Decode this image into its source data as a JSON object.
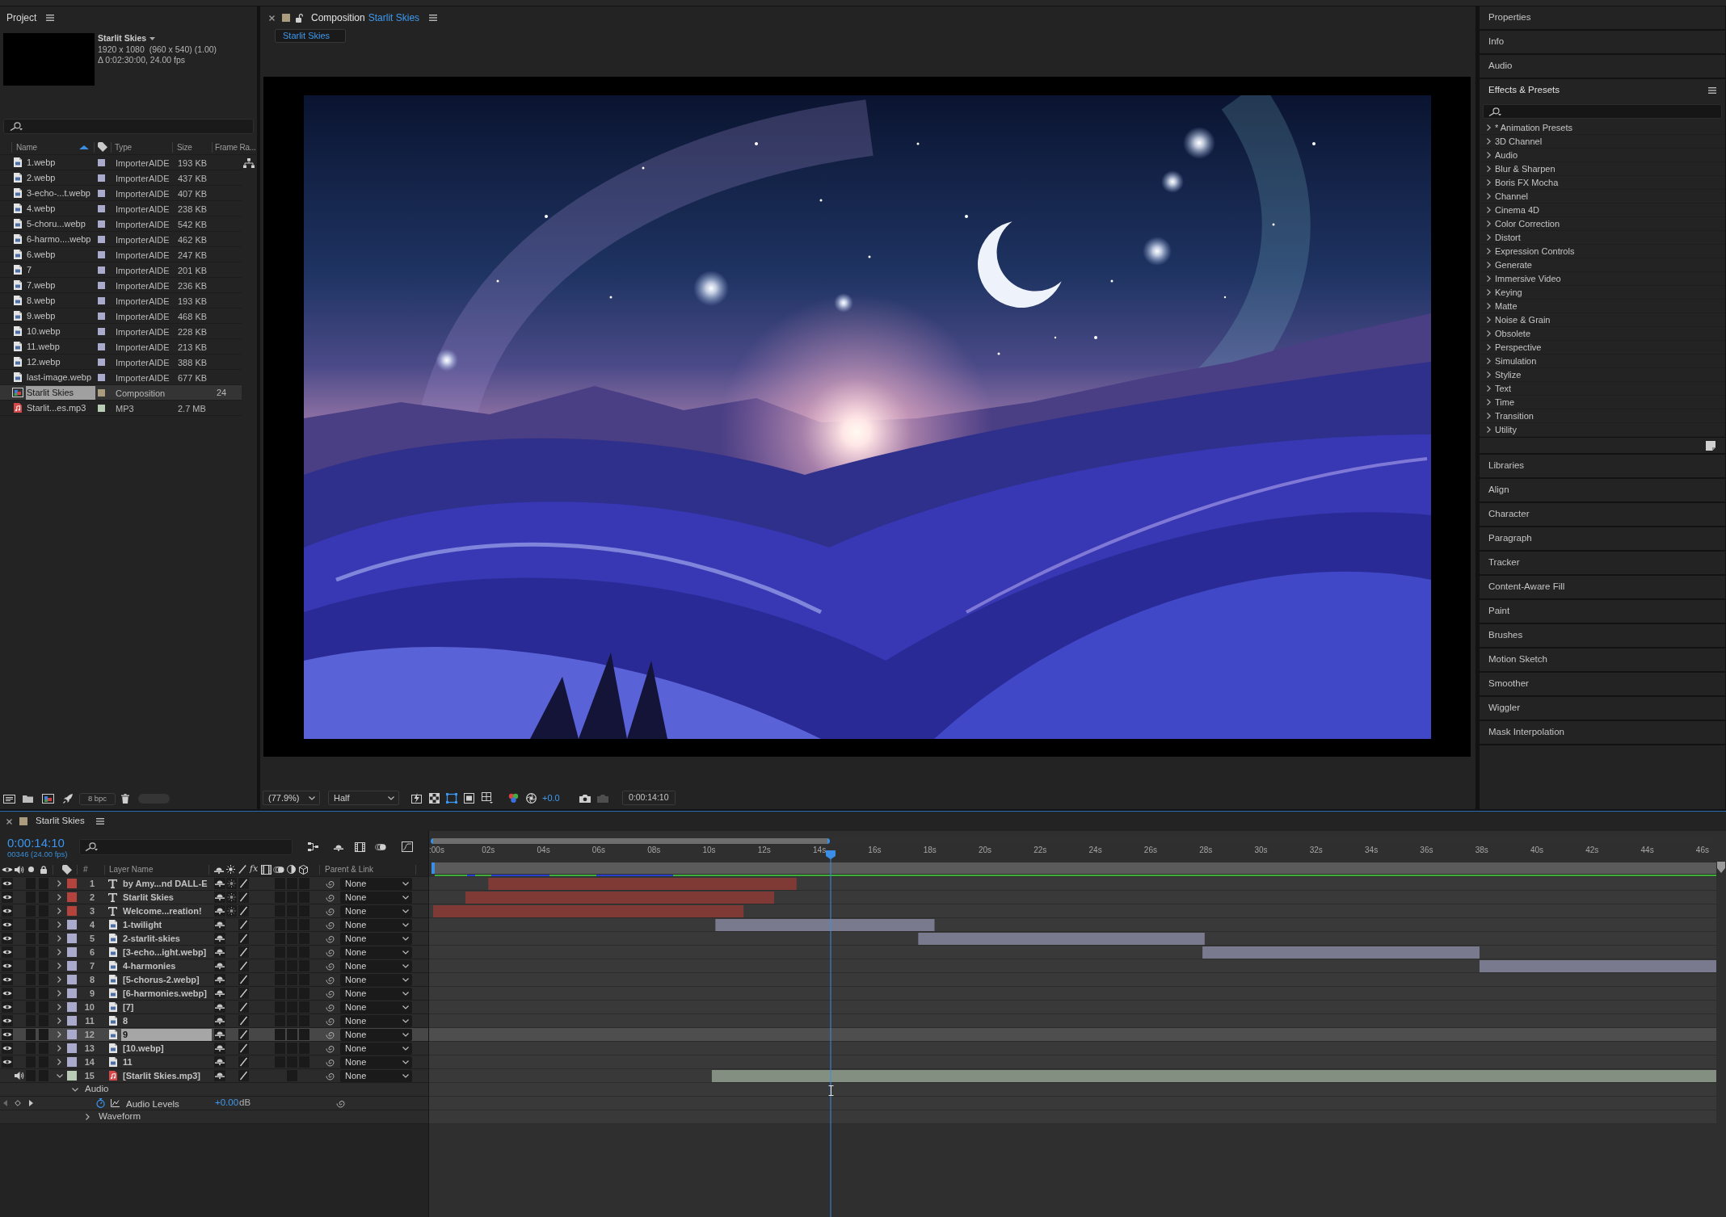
{
  "project": {
    "title": "Project",
    "preview": {
      "name": "Starlit Skies",
      "dimensions": "1920 x 1080  (960 x 540) (1.00)",
      "duration": "Δ 0:02:30:00, 24.00 fps"
    },
    "columns": [
      {
        "label": "Name",
        "sorted": true
      },
      {
        "label": "Type",
        "sorted": false
      },
      {
        "label": "Size",
        "sorted": false
      },
      {
        "label": "Frame Ra...",
        "sorted": false
      }
    ],
    "items": [
      {
        "kind": "image",
        "name": "1.webp",
        "color": "#aaaacc",
        "type": "ImporterAIDE",
        "size": "193 KB",
        "selected": false
      },
      {
        "kind": "image",
        "name": "2.webp",
        "color": "#aaaacc",
        "type": "ImporterAIDE",
        "size": "437 KB",
        "selected": false
      },
      {
        "kind": "image",
        "name": "3-echo-...t.webp",
        "color": "#aaaacc",
        "type": "ImporterAIDE",
        "size": "407 KB",
        "selected": false
      },
      {
        "kind": "image",
        "name": "4.webp",
        "color": "#aaaacc",
        "type": "ImporterAIDE",
        "size": "238 KB",
        "selected": false
      },
      {
        "kind": "image",
        "name": "5-choru...webp",
        "color": "#aaaacc",
        "type": "ImporterAIDE",
        "size": "542 KB",
        "selected": false
      },
      {
        "kind": "image",
        "name": "6-harmo....webp",
        "color": "#aaaacc",
        "type": "ImporterAIDE",
        "size": "462 KB",
        "selected": false
      },
      {
        "kind": "image",
        "name": "6.webp",
        "color": "#aaaacc",
        "type": "ImporterAIDE",
        "size": "247 KB",
        "selected": false
      },
      {
        "kind": "image",
        "name": "7",
        "color": "#aaaacc",
        "type": "ImporterAIDE",
        "size": "201 KB",
        "selected": false
      },
      {
        "kind": "image",
        "name": "7.webp",
        "color": "#aaaacc",
        "type": "ImporterAIDE",
        "size": "236 KB",
        "selected": false
      },
      {
        "kind": "image",
        "name": "8.webp",
        "color": "#aaaacc",
        "type": "ImporterAIDE",
        "size": "193 KB",
        "selected": false
      },
      {
        "kind": "image",
        "name": "9.webp",
        "color": "#aaaacc",
        "type": "ImporterAIDE",
        "size": "468 KB",
        "selected": false
      },
      {
        "kind": "image",
        "name": "10.webp",
        "color": "#aaaacc",
        "type": "ImporterAIDE",
        "size": "228 KB",
        "selected": false
      },
      {
        "kind": "image",
        "name": "11.webp",
        "color": "#aaaacc",
        "type": "ImporterAIDE",
        "size": "213 KB",
        "selected": false
      },
      {
        "kind": "image",
        "name": "12.webp",
        "color": "#aaaacc",
        "type": "ImporterAIDE",
        "size": "388 KB",
        "selected": false
      },
      {
        "kind": "image",
        "name": "last-image.webp",
        "color": "#aaaacc",
        "type": "ImporterAIDE",
        "size": "677 KB",
        "selected": false
      },
      {
        "kind": "composition",
        "name": "Starlit Skies",
        "color": "#ab9c7e",
        "type": "Composition",
        "frame_rate": "24",
        "selected": true
      },
      {
        "kind": "audio",
        "name": "Starlit...es.mp3",
        "color": "#b9cdb6",
        "type": "MP3",
        "size": "2.7 MB",
        "selected": false
      }
    ],
    "bit_depth": "8 bpc"
  },
  "composition": {
    "panel_title": "Composition",
    "name": "Starlit Skies",
    "tabs": [
      {
        "label": "Starlit Skies",
        "selected": true
      }
    ],
    "magnification": "(77.9%)",
    "resolution": "Half",
    "exposure": "+0.0",
    "timecode": "0:00:14:10"
  },
  "right_panels": {
    "collapsed_above": [
      "Properties",
      "Info",
      "Audio"
    ],
    "effects_presets": {
      "title": "Effects & Presets",
      "categories": [
        {
          "label": "* Animation Presets",
          "expanded": false
        },
        {
          "label": "3D Channel",
          "expanded": false
        },
        {
          "label": "Audio",
          "expanded": false
        },
        {
          "label": "Blur & Sharpen",
          "expanded": false
        },
        {
          "label": "Boris FX Mocha",
          "expanded": false
        },
        {
          "label": "Channel",
          "expanded": false
        },
        {
          "label": "Cinema 4D",
          "expanded": false
        },
        {
          "label": "Color Correction",
          "expanded": false
        },
        {
          "label": "Distort",
          "expanded": false
        },
        {
          "label": "Expression Controls",
          "expanded": false
        },
        {
          "label": "Generate",
          "expanded": false
        },
        {
          "label": "Immersive Video",
          "expanded": false
        },
        {
          "label": "Keying",
          "expanded": false
        },
        {
          "label": "Matte",
          "expanded": false
        },
        {
          "label": "Noise & Grain",
          "expanded": false
        },
        {
          "label": "Obsolete",
          "expanded": false
        },
        {
          "label": "Perspective",
          "expanded": false
        },
        {
          "label": "Simulation",
          "expanded": false
        },
        {
          "label": "Stylize",
          "expanded": false
        },
        {
          "label": "Text",
          "expanded": false
        },
        {
          "label": "Time",
          "expanded": false
        },
        {
          "label": "Transition",
          "expanded": false
        },
        {
          "label": "Utility",
          "expanded": false
        }
      ]
    },
    "collapsed_below": [
      "Libraries",
      "Align",
      "Character",
      "Paragraph",
      "Tracker",
      "Content-Aware Fill",
      "Paint",
      "Brushes",
      "Motion Sketch",
      "Smoother",
      "Wiggler",
      "Mask Interpolation"
    ]
  },
  "timeline": {
    "title": "Starlit Skies",
    "timecode": "0:00:14:10",
    "frame_info": "00346 (24.00 fps)",
    "columns": {
      "number": "#",
      "name": "Layer Name",
      "effects": "fx",
      "parent": "Parent & Link"
    },
    "ruler_labels": [
      ":00s",
      "02s",
      "04s",
      "06s",
      "08s",
      "10s",
      "12s",
      "14s",
      "16s",
      "18s",
      "20s",
      "22s",
      "24s",
      "26s",
      "28s",
      "30s",
      "32s",
      "34s",
      "36s",
      "38s",
      "40s",
      "42s",
      "44s",
      "46s"
    ],
    "layers": [
      {
        "number": "1",
        "kind": "text",
        "name": "by Amy...nd DALL-E",
        "color": "#b3433c",
        "enabled": true,
        "expanded": false,
        "selected": false,
        "parent": "None"
      },
      {
        "number": "2",
        "kind": "text",
        "name": "Starlit Skies",
        "color": "#b3433c",
        "enabled": true,
        "expanded": false,
        "selected": false,
        "parent": "None"
      },
      {
        "number": "3",
        "kind": "text",
        "name": "Welcome...reation!",
        "color": "#b3433c",
        "enabled": true,
        "expanded": false,
        "selected": false,
        "parent": "None"
      },
      {
        "number": "4",
        "kind": "image",
        "name": "1-twilight",
        "color": "#aaaacc",
        "enabled": true,
        "expanded": false,
        "selected": false,
        "parent": "None"
      },
      {
        "number": "5",
        "kind": "image",
        "name": "2-starlit-skies",
        "color": "#aaaacc",
        "enabled": true,
        "expanded": false,
        "selected": false,
        "parent": "None"
      },
      {
        "number": "6",
        "kind": "image",
        "name": "[3-echo...ight.webp]",
        "color": "#aaaacc",
        "enabled": true,
        "expanded": false,
        "selected": false,
        "parent": "None"
      },
      {
        "number": "7",
        "kind": "image",
        "name": "4-harmonies",
        "color": "#aaaacc",
        "enabled": true,
        "expanded": false,
        "selected": false,
        "parent": "None"
      },
      {
        "number": "8",
        "kind": "image",
        "name": "[5-chorus-2.webp]",
        "color": "#aaaacc",
        "enabled": true,
        "expanded": false,
        "selected": false,
        "parent": "None"
      },
      {
        "number": "9",
        "kind": "image",
        "name": "[6-harmonies.webp]",
        "color": "#aaaacc",
        "enabled": true,
        "expanded": false,
        "selected": false,
        "parent": "None"
      },
      {
        "number": "10",
        "kind": "image",
        "name": "[7]",
        "color": "#aaaacc",
        "enabled": true,
        "expanded": false,
        "selected": false,
        "parent": "None"
      },
      {
        "number": "11",
        "kind": "image",
        "name": "8",
        "color": "#aaaacc",
        "enabled": true,
        "expanded": false,
        "selected": false,
        "parent": "None"
      },
      {
        "number": "12",
        "kind": "image",
        "name": "9",
        "color": "#aaaacc",
        "enabled": true,
        "expanded": false,
        "selected": true,
        "parent": "None"
      },
      {
        "number": "13",
        "kind": "image",
        "name": "[10.webp]",
        "color": "#aaaacc",
        "enabled": true,
        "expanded": false,
        "selected": false,
        "parent": "None"
      },
      {
        "number": "14",
        "kind": "image",
        "name": "11",
        "color": "#aaaacc",
        "enabled": true,
        "expanded": false,
        "selected": false,
        "parent": "None"
      },
      {
        "number": "15",
        "kind": "audio",
        "name": "[Starlit Skies.mp3]",
        "color": "#b9cdb6",
        "enabled": true,
        "expanded": true,
        "selected": false,
        "parent": "None",
        "children": [
          {
            "kind": "group",
            "label": "Audio",
            "expanded": true,
            "children": [
              {
                "kind": "property",
                "label": "Audio Levels",
                "value": "+0.00",
                "unit": "dB"
              },
              {
                "kind": "group",
                "label": "Waveform",
                "expanded": false
              }
            ]
          }
        ]
      }
    ]
  }
}
